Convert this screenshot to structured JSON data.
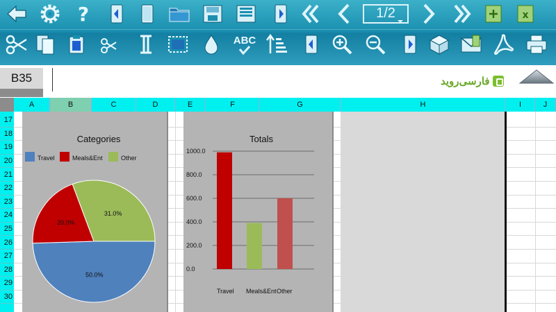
{
  "toolbar": {
    "row1_icons": [
      "back-arrow-icon",
      "gear-icon",
      "help-icon",
      "document-left-icon",
      "document-icon",
      "folder-icon",
      "save-icon",
      "save-as-icon",
      "document-right-icon",
      "first-page-icon",
      "previous-page-icon",
      "page-indicator",
      "next-page-icon",
      "last-page-icon",
      "add-sheet-icon",
      "excel-icon"
    ],
    "row2_icons": [
      "cut-icon",
      "copy-icon",
      "paste-icon",
      "cut-cells-icon",
      "text-cursor-icon",
      "select-area-icon",
      "fill-color-icon",
      "spell-check-icon",
      "sort-icon",
      "document-view-icon",
      "zoom-in-icon",
      "zoom-out-icon",
      "document-view-alt-icon",
      "box-icon",
      "mail-icon",
      "pdf-icon",
      "print-icon"
    ],
    "page_indicator": "1/2",
    "spell_label": "ABC",
    "accent": "#1a8fb0"
  },
  "namebar": {
    "cell_ref": "B35",
    "formula": "",
    "logo_text": "فارسی‌روید"
  },
  "columns": [
    {
      "label": "A",
      "selected": false
    },
    {
      "label": "B",
      "selected": true
    },
    {
      "label": "C",
      "selected": false
    },
    {
      "label": "D",
      "selected": false
    },
    {
      "label": "E",
      "selected": false
    },
    {
      "label": "F",
      "selected": false
    },
    {
      "label": "G",
      "selected": false
    },
    {
      "label": "H",
      "selected": false
    },
    {
      "label": "I",
      "selected": false
    },
    {
      "label": "J",
      "selected": false
    }
  ],
  "rows": [
    "17",
    "18",
    "19",
    "20",
    "21",
    "22",
    "23",
    "24",
    "25",
    "26",
    "27",
    "28",
    "29",
    "30"
  ],
  "chart_data": [
    {
      "type": "pie",
      "title": "Categories",
      "legend_placement": "top-left",
      "labels": [
        "Travel",
        "Meals&Ent",
        "Other"
      ],
      "values": [
        50.0,
        20.0,
        31.0
      ],
      "data_labels": [
        "50.0%",
        "20.0%",
        "31.0%"
      ],
      "colors": [
        "#4f81bd",
        "#c00000",
        "#9bbb59"
      ]
    },
    {
      "type": "bar",
      "title": "Totals",
      "categories": [
        "Travel",
        "Meals&Ent",
        "Other"
      ],
      "values": [
        990,
        390,
        600
      ],
      "colors": [
        "#c00000",
        "#9bbb59",
        "#c0504d"
      ],
      "ylim": [
        0,
        1000
      ],
      "yticks": [
        "0.0",
        "200.0",
        "400.0",
        "600.0",
        "800.0",
        "1000.0"
      ],
      "grid": true
    }
  ]
}
